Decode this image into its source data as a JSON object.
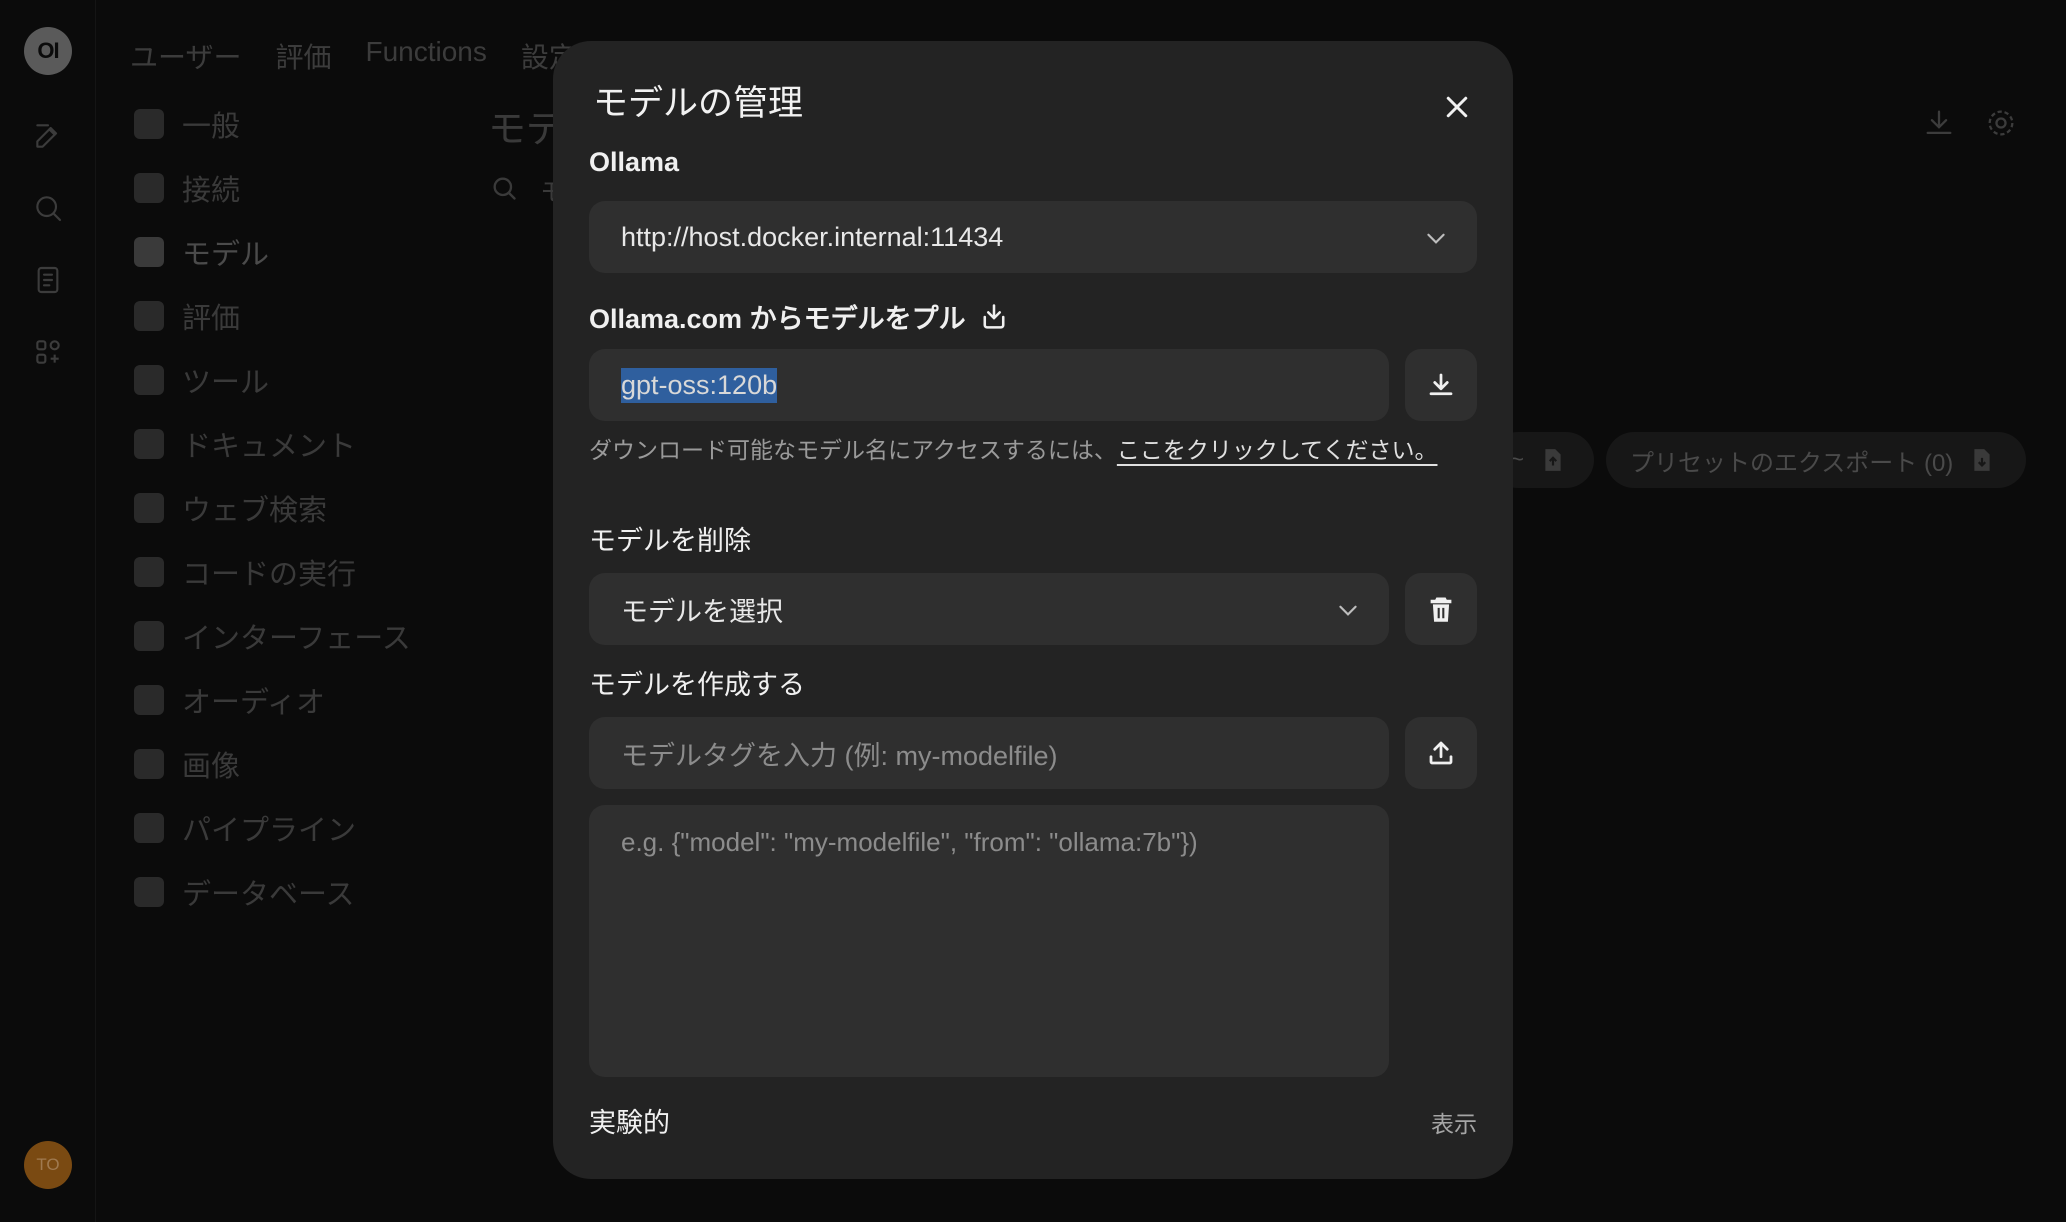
{
  "rail": {
    "logo_text": "OI",
    "avatar_text": "TO"
  },
  "topnav": {
    "items": [
      "ユーザー",
      "評価",
      "Functions",
      "設定"
    ]
  },
  "settings": {
    "items": [
      "一般",
      "接続",
      "モデル",
      "評価",
      "ツール",
      "ドキュメント",
      "ウェブ検索",
      "コードの実行",
      "インターフェース",
      "オーディオ",
      "画像",
      "パイプライン",
      "データベース"
    ],
    "active_index": 2
  },
  "background": {
    "page_title": "モデ",
    "search_text": "モ",
    "export_pill_label": "プリセットのエクスポート (0)",
    "import_pill_partial": "~"
  },
  "modal": {
    "title": "モデルの管理",
    "ollama_label": "Ollama",
    "ollama_url": "http://host.docker.internal:11434",
    "pull_label": "Ollama.com からモデルをプル",
    "pull_value": "gpt-oss:120b",
    "help_text": "ダウンロード可能なモデル名にアクセスするには、",
    "help_link": "ここをクリックしてください。",
    "delete_label": "モデルを削除",
    "delete_select": "モデルを選択",
    "create_label": "モデルを作成する",
    "create_tag_placeholder": "モデルタグを入力 (例: my-modelfile)",
    "create_json_placeholder": "e.g. {\"model\": \"my-modelfile\", \"from\": \"ollama:7b\"})",
    "experimental_label": "実験的",
    "experimental_toggle": "表示"
  },
  "colors": {
    "modal_bg": "#232323",
    "field_bg": "#2f2f2f",
    "selection": "#2f5f9e",
    "page_bg": "#0b0b0b"
  }
}
